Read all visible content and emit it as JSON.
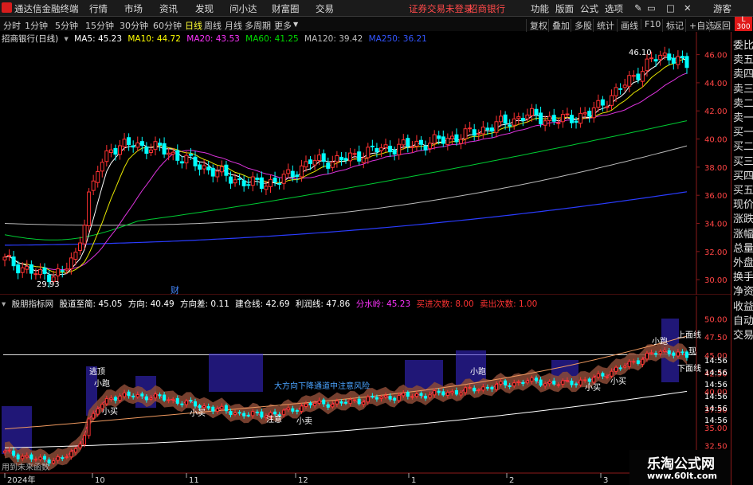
{
  "app": {
    "title": "通达信金融终端"
  },
  "menu": {
    "items": [
      "行情",
      "市场",
      "资讯",
      "发现",
      "问小达",
      "财富圈",
      "交易"
    ],
    "notice": "证券交易未登录",
    "stock_link": "招商银行",
    "right_items": [
      "功能",
      "版面",
      "公式",
      "选项"
    ],
    "guest": "游客"
  },
  "periods": {
    "items": [
      "分时",
      "1分钟",
      "5分钟",
      "15分钟",
      "30分钟",
      "60分钟",
      "日线",
      "周线",
      "月线",
      "多周期",
      "更多"
    ],
    "active": "日线"
  },
  "toolbar": {
    "items": [
      "复权",
      "叠加",
      "多股",
      "统计",
      "画线",
      "F10",
      "标记",
      "+自选",
      "返回"
    ]
  },
  "main_chart": {
    "stock_label": "招商银行(日线)",
    "ma": [
      {
        "label": "MA5: 45.23",
        "color": "#ffffff"
      },
      {
        "label": "MA10: 44.72",
        "color": "#ffff00"
      },
      {
        "label": "MA20: 43.53",
        "color": "#ff33ff"
      },
      {
        "label": "MA60: 41.25",
        "color": "#00dd00"
      },
      {
        "label": "MA120: 39.42",
        "color": "#bbbbbb"
      },
      {
        "label": "MA250: 36.21",
        "color": "#3355ff"
      }
    ],
    "y_ticks": [
      "46.00",
      "44.00",
      "42.00",
      "40.00",
      "38.00",
      "36.00",
      "34.00",
      "32.00",
      "30.00"
    ],
    "high_label": "46.10",
    "low_label": "29.93",
    "event_label": "财"
  },
  "indicator": {
    "name": "殷朋指标网",
    "values": [
      {
        "label": "股道至简: 45.05",
        "color": "#ffffff"
      },
      {
        "label": "方向: 40.49",
        "color": "#ffffff"
      },
      {
        "label": "方向差: 0.11",
        "color": "#ffffff"
      },
      {
        "label": "建仓线: 42.69",
        "color": "#ffffff"
      },
      {
        "label": "利润线: 47.86",
        "color": "#ffffff"
      },
      {
        "label": "分水岭: 45.23",
        "color": "#ff33ff"
      },
      {
        "label": "买进次数: 8.00",
        "color": "#ff3333"
      },
      {
        "label": "卖出次数: 1.00",
        "color": "#ff3333"
      }
    ],
    "y_ticks": [
      "50.00",
      "47.50",
      "45.00",
      "42.50",
      "40.00",
      "37.50",
      "35.00",
      "32.50"
    ],
    "annotations": [
      "逃顶",
      "小跑",
      "小买",
      "小买",
      "大方向下降通道中注意风险",
      "小跑",
      "小买",
      "小买",
      "注意",
      "小卖",
      "小跑",
      "上面线",
      "现",
      "下面线"
    ],
    "bottom_note": "用到未来函数"
  },
  "x_axis": {
    "labels": [
      "2024年",
      "10",
      "11",
      "12",
      "1",
      "2",
      "3"
    ]
  },
  "sidebar": {
    "items": [
      "委比",
      "卖五",
      "卖四",
      "卖三",
      "卖二",
      "卖一",
      "买一",
      "买二",
      "买三",
      "买四",
      "买五",
      "现价",
      "涨跌",
      "涨幅",
      "总量",
      "外盘",
      "换手",
      "净资",
      "收益",
      "自动",
      "交易"
    ]
  },
  "watermark": {
    "title": "乐淘公式网",
    "url": "www.60lt.com"
  },
  "colors": {
    "up": "#ff3232",
    "down": "#00ffff",
    "grid": "#8b1a1a",
    "band": "#3a2ad8"
  }
}
